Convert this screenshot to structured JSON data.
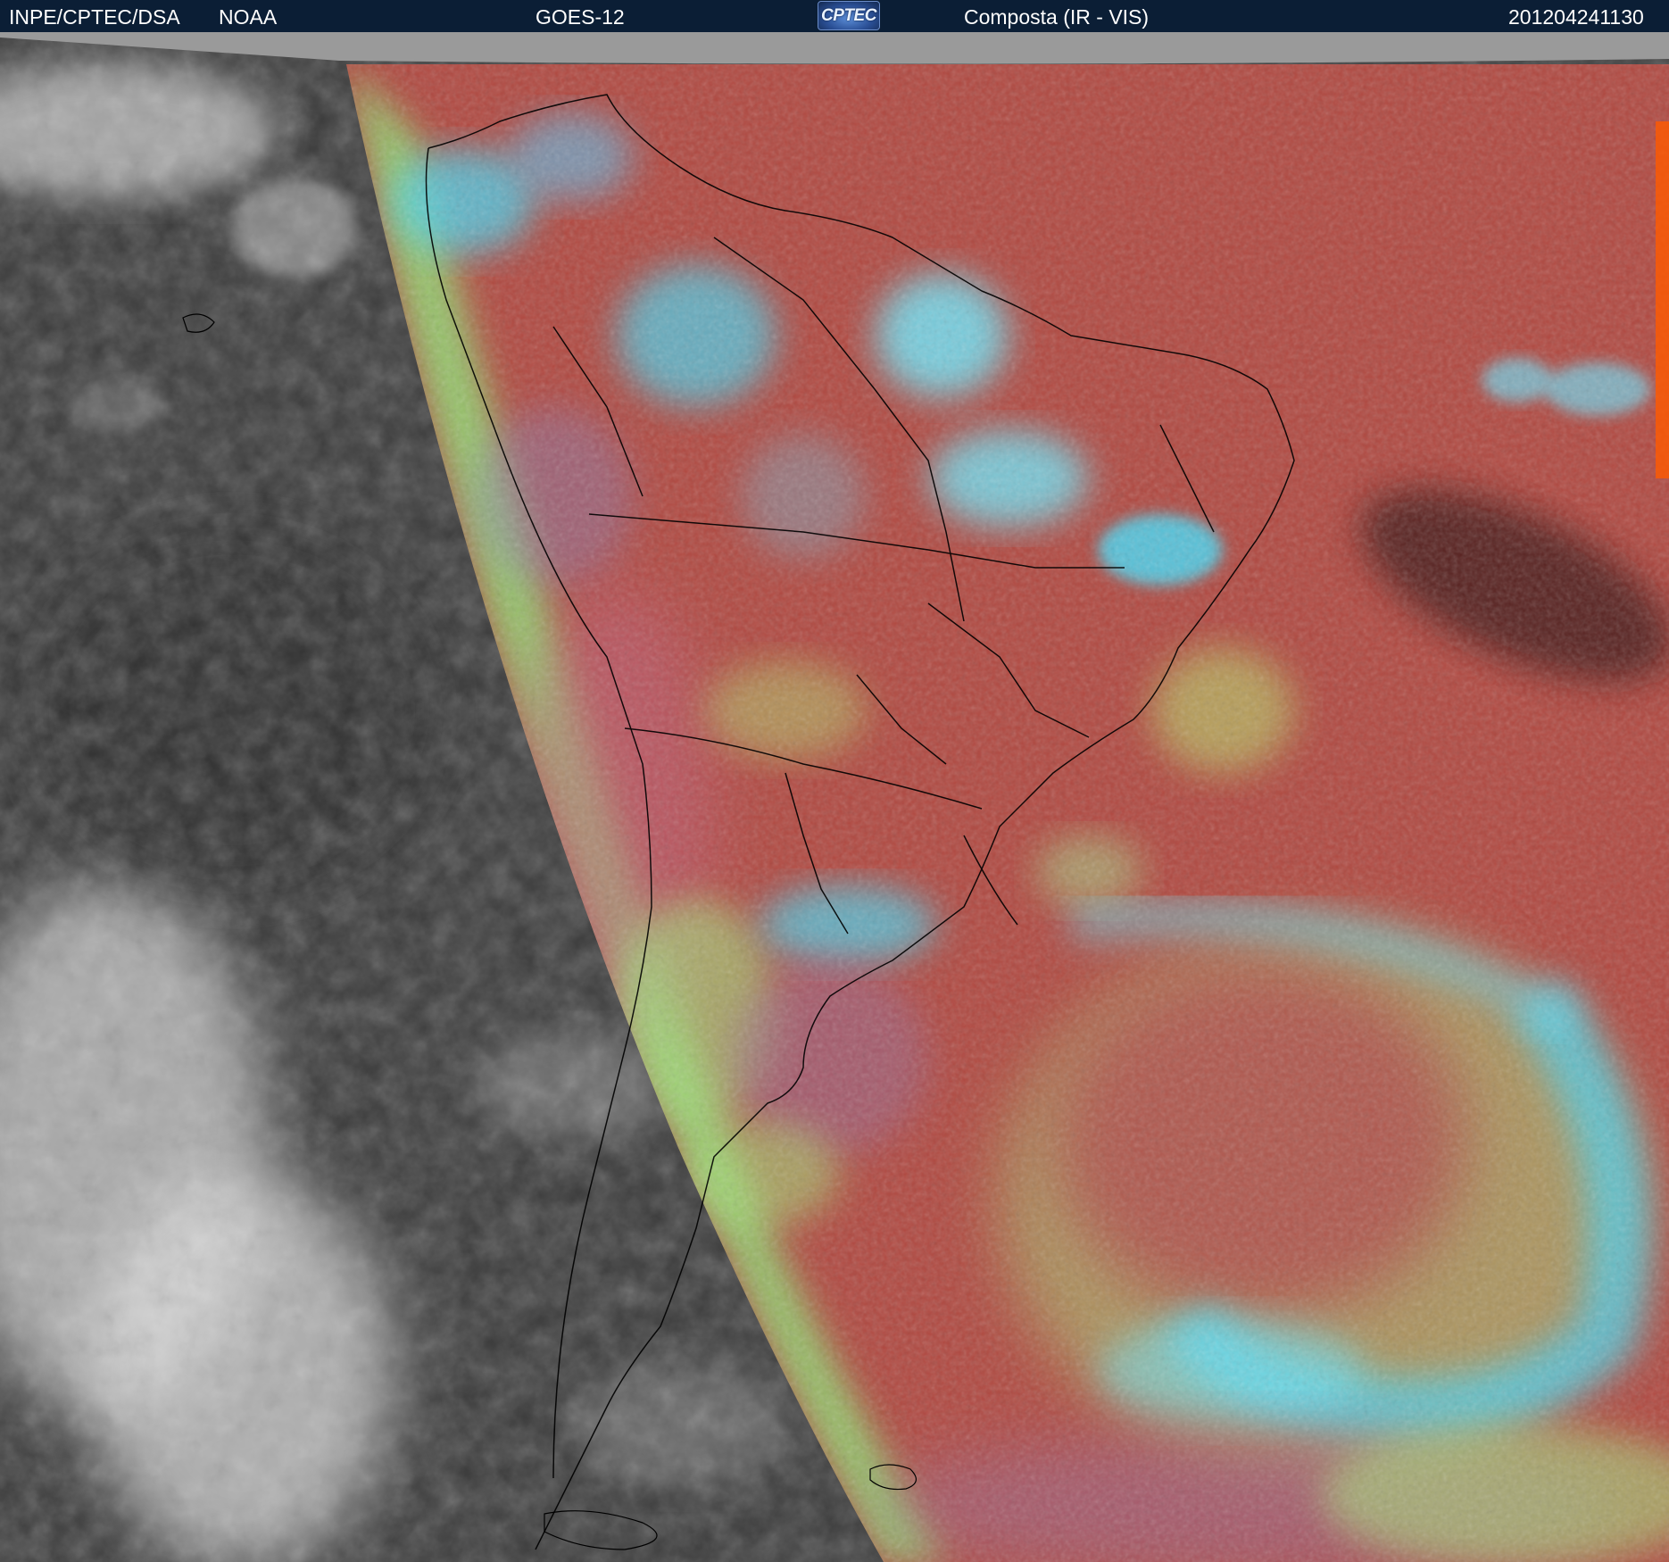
{
  "header": {
    "institution": "INPE/CPTEC/DSA",
    "agency": "NOAA",
    "satellite": "GOES-12",
    "logo_text": "CPTEC",
    "product": "Composta (IR - VIS)",
    "timestamp": "201204241130"
  },
  "image": {
    "subject": "satellite-composite",
    "colors": {
      "header_bg": "#0b1e35",
      "header_text": "#ffffff",
      "ir_dark": "#3a3a3a",
      "ir_cloud": "#d8d8d8",
      "composite_red": "#b04840",
      "composite_cyan": "#49d6f2",
      "composite_green": "#8ee878",
      "no_data": "#9a9a9a",
      "border_lines": "#000000"
    }
  }
}
